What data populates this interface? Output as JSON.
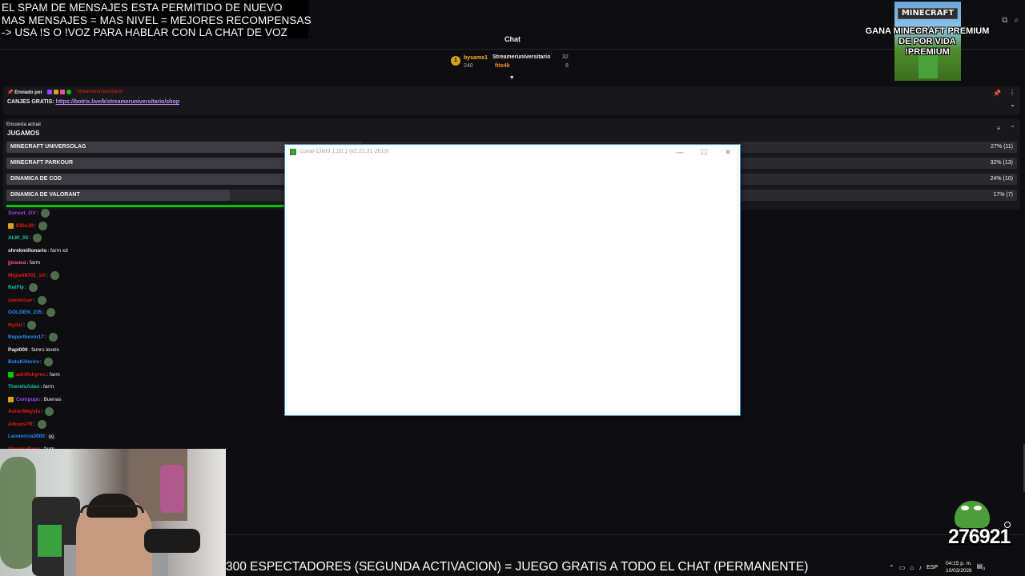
{
  "overlay": {
    "lines": [
      "EL SPAM DE MENSAJES ESTA PERMITIDO DE NUEVO",
      "MAS MENSAJES = MAS NIVEL = MEJORES RECOMPENSAS",
      "-> USA !S O !VOZ PARA HABLAR CON LA CHAT DE VOZ"
    ]
  },
  "chat": {
    "title": "Chat"
  },
  "leaderboard": {
    "first_rank": "1",
    "first_name": "bysamx1",
    "first_count": "240",
    "second_name": "Streameruniversitario",
    "second_count": "32",
    "third_name": "fito4k",
    "third_count": "8"
  },
  "promo": {
    "logo": "MINECRAFT",
    "text_lines": [
      "GANA MINECRAFT PREMIUM",
      "DE POR VIDA",
      "!PREMIUM"
    ]
  },
  "pinned": {
    "sent_by": "Enviado por",
    "sender": "Streameruniversitario",
    "message_prefix": "CANJES GRATIS:",
    "link": "https://botrix.live/k/streameruniversitario/shop"
  },
  "poll": {
    "current": "Encuesta actual",
    "title": "JUGAMOS",
    "options": [
      {
        "label": "MINECRAFT UNIVERSOLAG",
        "pct": "27% (11)",
        "fraction": 0.27
      },
      {
        "label": "MINECRAFT PARKOUR",
        "pct": "32% (13)",
        "fraction": 0.32
      },
      {
        "label": "DINAMICA DE COD",
        "pct": "24% (10)",
        "fraction": 0.24
      },
      {
        "label": "DINAMICA DE VALORANT",
        "pct": "17% (7)",
        "fraction": 0.17
      }
    ]
  },
  "messages": [
    {
      "user": "Sunset_GV",
      "text": ":",
      "color": "#9147ff",
      "emote": true
    },
    {
      "user": "ElDeJ0",
      "text": ":",
      "color": "#e91916",
      "emote": true,
      "pre": "#d9a21b"
    },
    {
      "user": "ALW_05",
      "text": ":",
      "color": "#00c8af",
      "emote": true
    },
    {
      "user": "shrekmillonario",
      "text": ": farm xd",
      "color": "#efeff1",
      "emote": false
    },
    {
      "user": "jjosuea",
      "text": ": farm",
      "color": "#ff4f9a",
      "emote": false
    },
    {
      "user": "Miguel8701_str",
      "text": ":",
      "color": "#e91916",
      "emote": true
    },
    {
      "user": "RetFly",
      "text": ":",
      "color": "#00c8af",
      "emote": true
    },
    {
      "user": "zamoriser",
      "text": ":",
      "color": "#e91916",
      "emote": true
    },
    {
      "user": "GOLDEN_235",
      "text": ":",
      "color": "#1e90ff",
      "emote": true
    },
    {
      "user": "Hyzur",
      "text": ":",
      "color": "#e91916",
      "emote": true
    },
    {
      "user": "Reportkevin17",
      "text": ":",
      "color": "#1e90ff",
      "emote": true
    },
    {
      "user": "Papi000",
      "text": ": famrs levels",
      "color": "#efeff1",
      "emote": false
    },
    {
      "user": "BotsKilleriro",
      "text": ":",
      "color": "#1e90ff",
      "emote": true
    },
    {
      "user": "adrilfshyrnc",
      "text": ": farm",
      "color": "#e91916",
      "emote": false,
      "pre": "#00c800"
    },
    {
      "user": "ThereIsAdan",
      "text": ": farm",
      "color": "#00c8af",
      "emote": false
    },
    {
      "user": "Compupc",
      "text": ": Buenas",
      "color": "#9147ff",
      "emote": false,
      "pre": "#d9a21b"
    },
    {
      "user": "AsherMeyslo",
      "text": ":",
      "color": "#e91916",
      "emote": true
    },
    {
      "user": "Arkoos7R",
      "text": ":",
      "color": "#e91916",
      "emote": true
    },
    {
      "user": "Leonercra3000",
      "text": ": gg",
      "color": "#1e90ff",
      "emote": false
    },
    {
      "user": "ShooterBoss",
      "text": ": farm",
      "color": "#e91916",
      "emote": false
    }
  ],
  "window": {
    "title": "Lunar Client 1.20.1 (v2.21.31-2610)",
    "minimize": "—",
    "maximize": "☐",
    "close": "✕"
  },
  "ticker": "300 ESPECTADORES (SEGUNDA ACTIVACION) = JUEGO GRATIS A TODO EL CHAT (PERMANENTE)",
  "viewers": "276921",
  "tray": {
    "lang": "ESP",
    "time": "04:15 p. m.",
    "date": "10/03/2026",
    "notif": "4"
  },
  "icons": {
    "search": "search-icon",
    "pin": "pin-icon",
    "more": "more-vertical-icon"
  }
}
